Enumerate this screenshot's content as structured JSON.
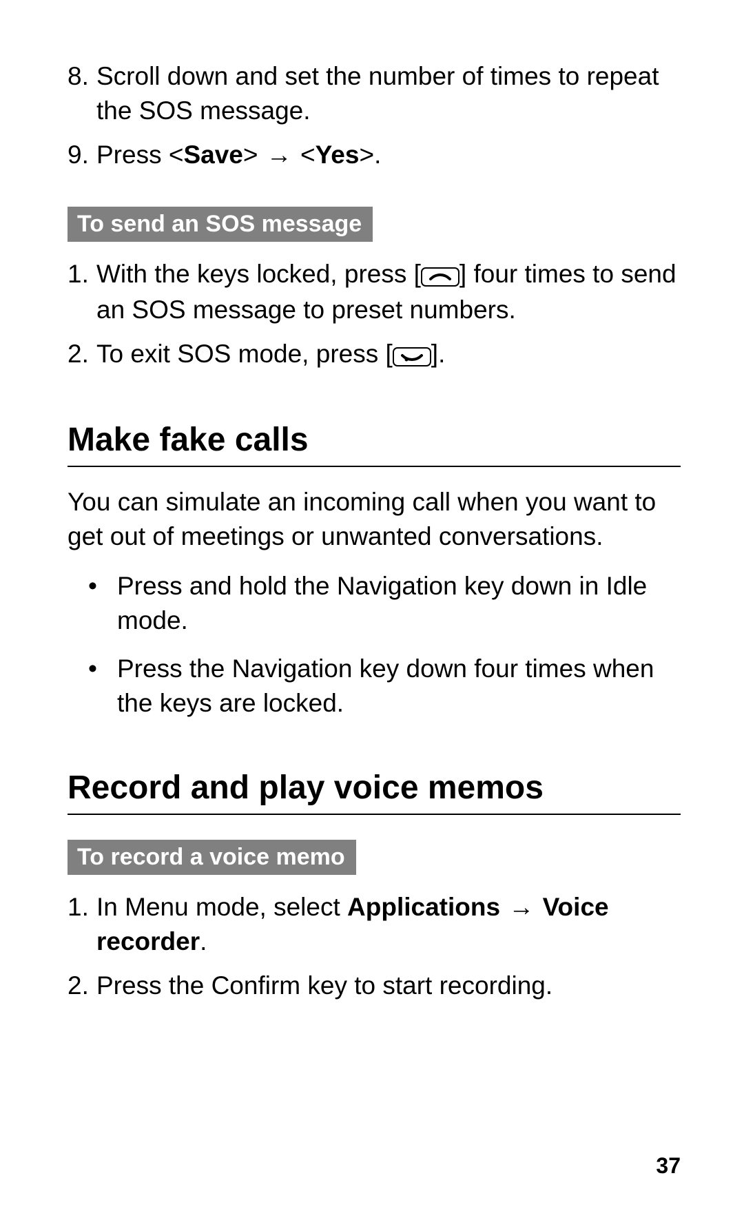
{
  "page_number": "37",
  "prev_list": {
    "items": [
      {
        "num": "8.",
        "text": "Scroll down and set the number of times to repeat the SOS message."
      },
      {
        "num": "9.",
        "prefix": "Press <",
        "bold1": "Save",
        "mid": "> ",
        "arrow": "→",
        "mid2": " <",
        "bold2": "Yes",
        "suffix": ">."
      }
    ]
  },
  "sos_send": {
    "heading": "To send an SOS message",
    "items": [
      {
        "num": "1.",
        "before": "With the keys locked, press [",
        "icon": "call-icon",
        "after": "] four times to send an SOS message to preset numbers."
      },
      {
        "num": "2.",
        "before": "To exit SOS mode, press [",
        "icon": "end-icon",
        "after": "]."
      }
    ]
  },
  "fake_calls": {
    "title": "Make fake calls",
    "intro": "You can simulate an incoming call when you want to get out of meetings or unwanted conversations.",
    "bullets": [
      "Press and hold the Navigation key down in Idle mode.",
      "Press the Navigation key down four times when the keys are locked."
    ]
  },
  "voice_memos": {
    "title": "Record and play voice memos",
    "sub_heading": "To record a voice memo",
    "items": [
      {
        "num": "1.",
        "prefix": "In Menu mode, select ",
        "bold1": "Applications",
        "mid": " ",
        "arrow": "→",
        "mid2": " ",
        "bold2": "Voice recorder",
        "suffix": "."
      },
      {
        "num": "2.",
        "text": "Press the Confirm key to start recording."
      }
    ]
  }
}
